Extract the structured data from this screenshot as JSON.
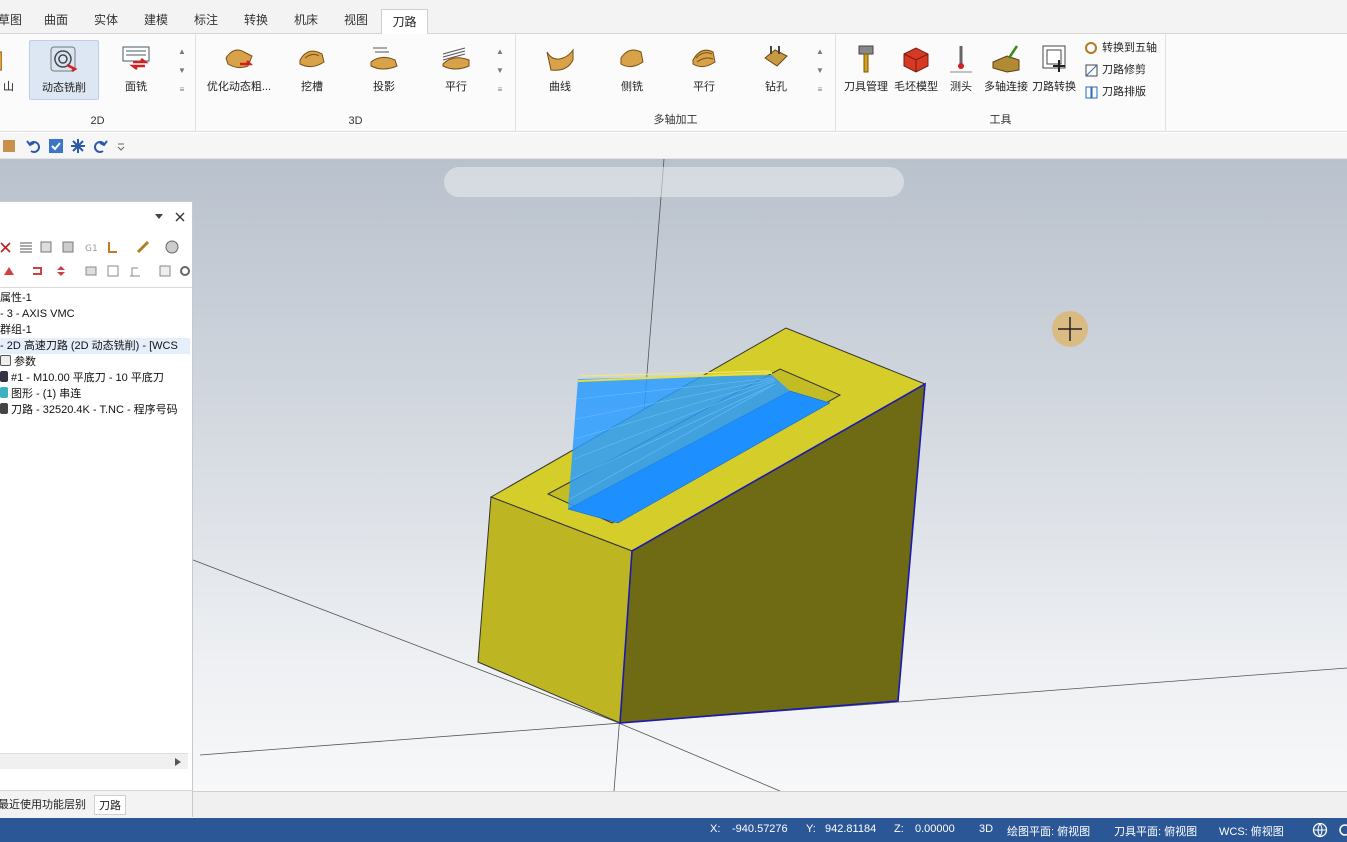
{
  "tabs": [
    {
      "label": "草图",
      "active": false
    },
    {
      "label": "曲面",
      "active": false
    },
    {
      "label": "实体",
      "active": false
    },
    {
      "label": "建模",
      "active": false
    },
    {
      "label": "标注",
      "active": false
    },
    {
      "label": "转换",
      "active": false
    },
    {
      "label": "机床",
      "active": false
    },
    {
      "label": "视图",
      "active": false
    },
    {
      "label": "刀路",
      "active": true
    }
  ],
  "ribbon": {
    "group_2d": {
      "label": "2D",
      "buttons": [
        "动态铣削",
        "面铣"
      ]
    },
    "group_3d": {
      "label": "3D",
      "buttons": [
        "优化动态粗...",
        "挖槽",
        "投影",
        "平行"
      ]
    },
    "group_multiaxis": {
      "label": "多轴加工",
      "buttons": [
        "曲线",
        "侧铣",
        "平行",
        "钻孔"
      ]
    },
    "group_tools": {
      "label": "工具",
      "buttons": [
        "刀具管理",
        "毛坯模型",
        "测头",
        "多轴连接",
        "刀路转换"
      ],
      "small_buttons": [
        "转换到五轴",
        "刀路修剪",
        "刀路排版"
      ]
    }
  },
  "tree": [
    {
      "text": "属性-1"
    },
    {
      "text": "- 3 - AXIS VMC"
    },
    {
      "text": "群组-1"
    },
    {
      "text": "- 2D 高速刀路 (2D 动态铣削) - [WCS"
    },
    {
      "text": "参数"
    },
    {
      "text": "#1 - M10.00 平底刀 - 10 平底刀"
    },
    {
      "text": "图形 - (1) 串连"
    },
    {
      "text": "刀路 - 32520.4K - T.NC - 程序号码"
    }
  ],
  "panel_tabs": [
    {
      "label": "最近使用功能",
      "active": false
    },
    {
      "label": "层别",
      "active": false
    },
    {
      "label": "刀路",
      "active": true
    }
  ],
  "status": {
    "x_label": "X:",
    "x_value": "-940.57276",
    "y_label": "Y:",
    "y_value": "942.81184",
    "z_label": "Z:",
    "z_value": "0.00000",
    "mode": "3D",
    "draw_plane": "绘图平面: 俯视图",
    "tool_plane": "刀具平面: 俯视图",
    "wcs": "WCS: 俯视图"
  },
  "colors": {
    "part_face": "#c9c42c",
    "part_dark": "#6b6512",
    "toolpath": "#1e8fff",
    "status_bar": "#2b5797"
  }
}
